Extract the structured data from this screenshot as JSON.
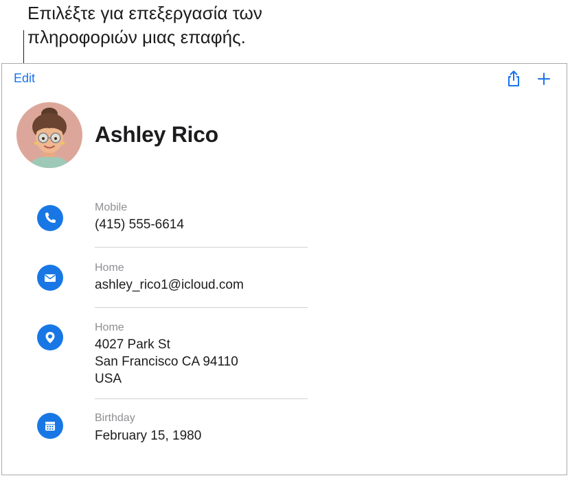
{
  "callout": {
    "line1": "Επιλέξτε για επεξεργασία των",
    "line2": "πληροφοριών μιας επαφής."
  },
  "toolbar": {
    "edit_label": "Edit",
    "share_icon": "share-icon",
    "add_icon": "plus-icon"
  },
  "contact": {
    "name": "Ashley Rico",
    "avatar": "memoji-avatar"
  },
  "fields": {
    "phone": {
      "label": "Mobile",
      "value": "(415) 555-6614",
      "icon": "phone-icon"
    },
    "email": {
      "label": "Home",
      "value": "ashley_rico1@icloud.com",
      "icon": "envelope-icon"
    },
    "address": {
      "label": "Home",
      "line1": "4027 Park St",
      "line2": "San Francisco CA 94110",
      "line3": "USA",
      "icon": "map-pin-icon"
    },
    "birthday": {
      "label": "Birthday",
      "value": "February 15, 1980",
      "icon": "calendar-icon"
    }
  },
  "colors": {
    "accent": "#1877e5",
    "link": "#1a73e8",
    "separator": "#d1d1d6",
    "secondary_text": "#8e8e93"
  }
}
